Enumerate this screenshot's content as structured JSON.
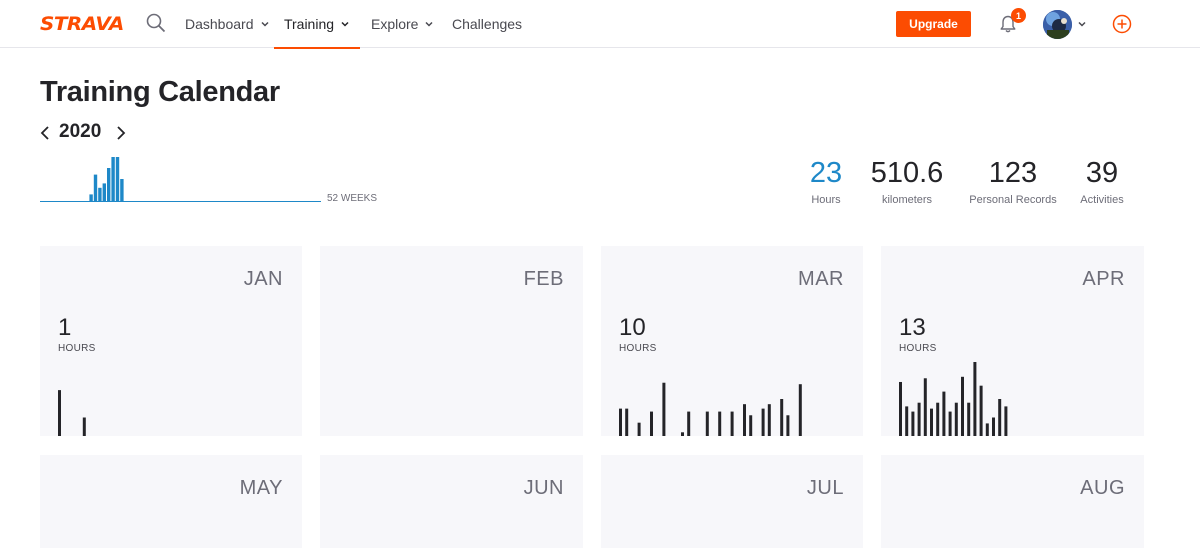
{
  "nav": {
    "logo": "STRAVA",
    "items": [
      {
        "label": "Dashboard"
      },
      {
        "label": "Training"
      },
      {
        "label": "Explore"
      },
      {
        "label": "Challenges"
      }
    ],
    "upgrade_label": "Upgrade",
    "notification_count": "1",
    "accent_color": "#fc4c02"
  },
  "header": {
    "title": "Training Calendar",
    "year": "2020",
    "weeks_label": "52 WEEKS",
    "weekly_bars": [
      0,
      0,
      0,
      0,
      0,
      0,
      0,
      0,
      0,
      0,
      0,
      0.15,
      0.6,
      0.3,
      0.4,
      0.75,
      1.0,
      1.0,
      0.5
    ]
  },
  "stats": [
    {
      "value": "23",
      "label": "Hours"
    },
    {
      "value": "510.6",
      "label": "kilometers"
    },
    {
      "value": "123",
      "label": "Personal Records"
    },
    {
      "value": "39",
      "label": "Activities"
    }
  ],
  "months": [
    {
      "name": "JAN",
      "value": "1",
      "unit": "HOURS",
      "bars": [
        0.62,
        0,
        0,
        0,
        0.25
      ]
    },
    {
      "name": "FEB",
      "value": "",
      "unit": "",
      "bars": []
    },
    {
      "name": "MAR",
      "value": "10",
      "unit": "HOURS",
      "bars": [
        0.37,
        0.37,
        0,
        0.18,
        0,
        0.33,
        0,
        0.72,
        0,
        0,
        0.05,
        0.33,
        0,
        0,
        0.33,
        0,
        0.33,
        0,
        0.33,
        0,
        0.43,
        0.28,
        0,
        0.37,
        0.43,
        0,
        0.5,
        0.28,
        0,
        0.7
      ]
    },
    {
      "name": "APR",
      "value": "13",
      "unit": "HOURS",
      "bars": [
        0.73,
        0.4,
        0.33,
        0.45,
        0.78,
        0.37,
        0.45,
        0.6,
        0.33,
        0.45,
        0.8,
        0.45,
        1.0,
        0.68,
        0.17,
        0.25,
        0.5,
        0.4
      ]
    },
    {
      "name": "MAY",
      "value": "",
      "unit": "",
      "bars": []
    },
    {
      "name": "JUN",
      "value": "",
      "unit": "",
      "bars": []
    },
    {
      "name": "JUL",
      "value": "",
      "unit": "",
      "bars": []
    },
    {
      "name": "AUG",
      "value": "",
      "unit": "",
      "bars": []
    }
  ]
}
